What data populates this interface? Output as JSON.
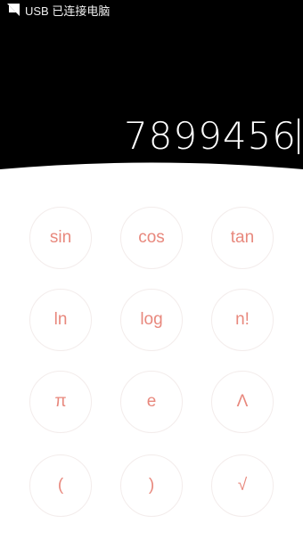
{
  "status_bar": {
    "usb_text": "USB 已连接电脑",
    "usb_icon": "usb-debug-icon"
  },
  "display": {
    "value": "7899456"
  },
  "colors": {
    "key_text": "#e8887d",
    "key_border": "#f3eceb",
    "top_bg": "#000000"
  },
  "keys": [
    [
      "sin",
      "cos",
      "tan"
    ],
    [
      "ln",
      "log",
      "n!"
    ],
    [
      "π",
      "e",
      "Λ"
    ],
    [
      "(",
      ")",
      "√"
    ]
  ]
}
